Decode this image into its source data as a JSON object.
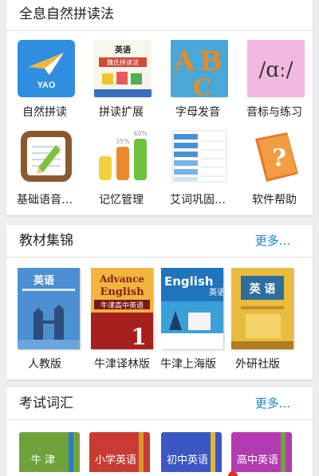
{
  "section1": {
    "title": "全息自然拼读法",
    "items": [
      {
        "label": "自然拼读",
        "icon": "paper-plane-icon"
      },
      {
        "label": "拼读扩展",
        "icon": "book-cover-icon"
      },
      {
        "label": "字母发音",
        "icon": "abc-letters-icon"
      },
      {
        "label": "音标与练习",
        "icon": "phonetic-symbol-icon"
      },
      {
        "label": "基础语音…",
        "icon": "notepad-pencil-icon"
      },
      {
        "label": "记忆管理",
        "icon": "bar-chart-icon"
      },
      {
        "label": "艾词巩固…",
        "icon": "schedule-table-icon"
      },
      {
        "label": "软件帮助",
        "icon": "question-book-icon"
      }
    ],
    "badges": {
      "plane_text": "YAO",
      "book_title": "英语",
      "book_sub": "魏氏拼读法",
      "phonetic": "/ɑː/",
      "chart_35": "35%",
      "chart_40": "40%",
      "help_mark": "?"
    }
  },
  "section2": {
    "title": "教材集锦",
    "more": "更多...",
    "books": [
      {
        "label": "人教版",
        "cover_text": "英语"
      },
      {
        "label": "牛津译林版",
        "cover_text": "Advance English",
        "cover_sub": "牛津高中英语",
        "cover_num": "1"
      },
      {
        "label": "牛津上海版",
        "cover_text": "English",
        "cover_sub": "英语"
      },
      {
        "label": "外研社版",
        "cover_text": "英 语"
      }
    ]
  },
  "section3": {
    "title": "考试词汇",
    "more": "更多...",
    "items": [
      {
        "label": "牛 津",
        "color": "#6fa33a"
      },
      {
        "label": "小学英语",
        "color": "#c83b33"
      },
      {
        "label": "初中英语",
        "color": "#3a57c4"
      },
      {
        "label": "高中英语",
        "color": "#b33ab0"
      }
    ]
  }
}
